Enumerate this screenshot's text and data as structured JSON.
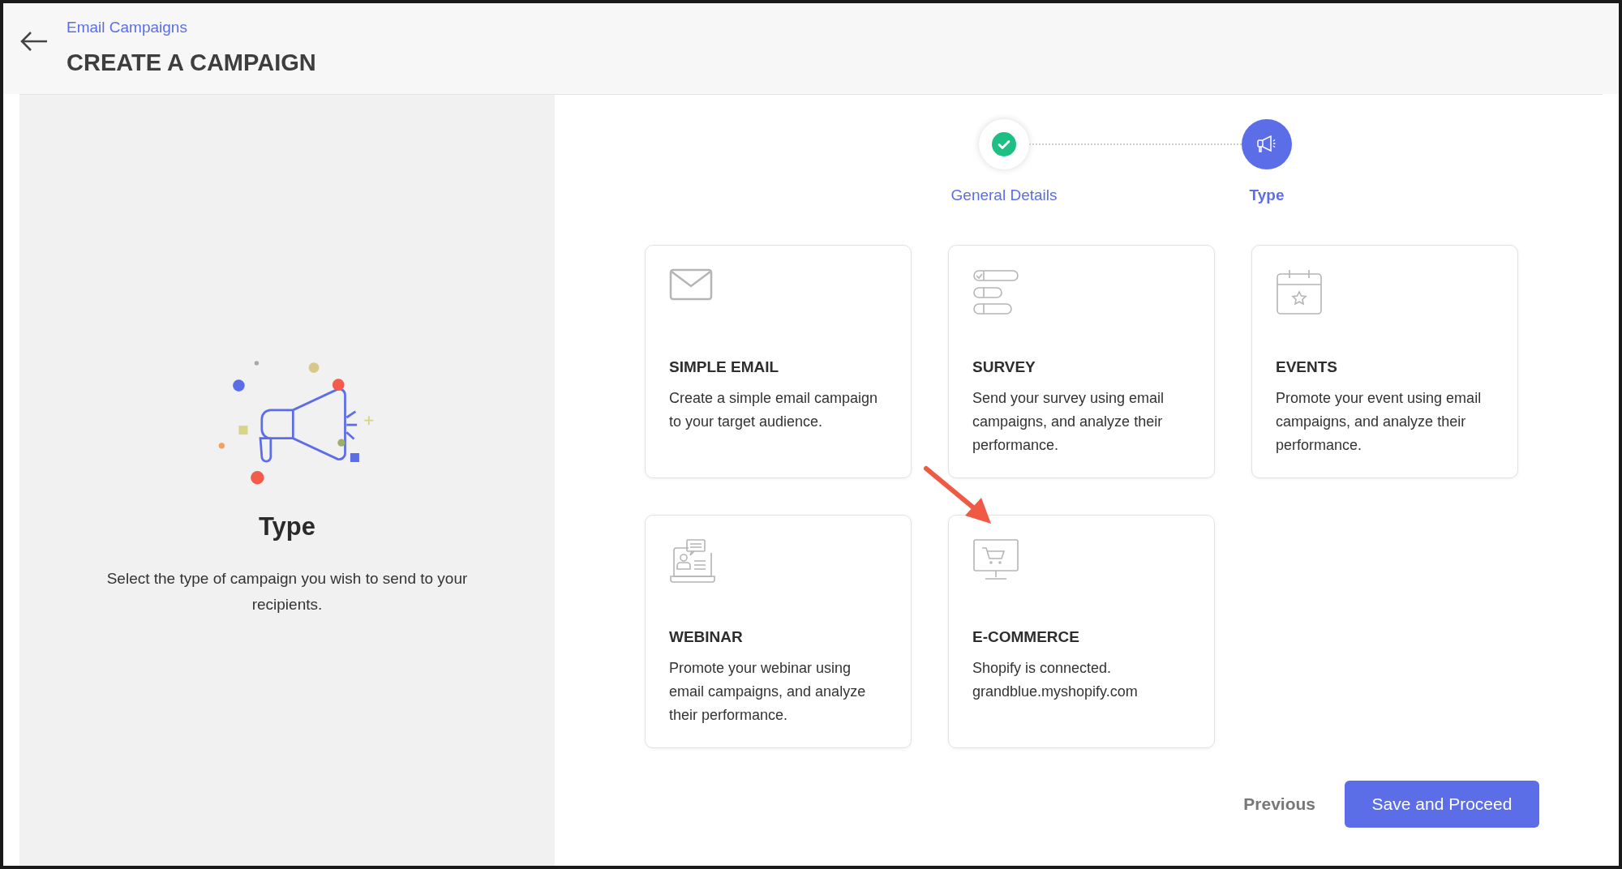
{
  "header": {
    "breadcrumb": "Email Campaigns",
    "title": "CREATE A CAMPAIGN"
  },
  "side_panel": {
    "title": "Type",
    "description": "Select the type of campaign you wish to send to your recipients."
  },
  "steps": [
    {
      "label": "General Details",
      "kind": "done",
      "selected": false
    },
    {
      "label": "Type",
      "kind": "campaign",
      "selected": true
    }
  ],
  "cards": [
    {
      "kind": "email",
      "title": "SIMPLE EMAIL",
      "description": "Create a simple email campaign to your target audience."
    },
    {
      "kind": "survey",
      "title": "SURVEY",
      "description": "Send your survey using email campaigns, and analyze their performance."
    },
    {
      "kind": "events",
      "title": "EVENTS",
      "description": "Promote your event using email campaigns, and analyze their performance."
    },
    {
      "kind": "webinar",
      "title": "WEBINAR",
      "description": "Promote your webinar using email campaigns, and analyze their performance."
    },
    {
      "kind": "ecommerce",
      "title": "E-COMMERCE",
      "description": "Shopify is connected. grandblue.myshopify.com"
    }
  ],
  "buttons": {
    "previous": "Previous",
    "proceed": "Save and Proceed"
  }
}
